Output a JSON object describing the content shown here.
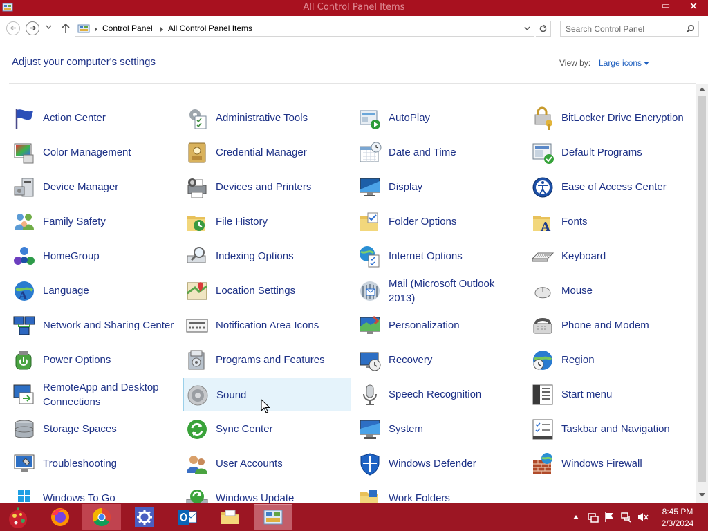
{
  "window": {
    "title": "All Control Panel Items",
    "minimize": "—",
    "maximize": "▭",
    "close": "✕"
  },
  "address": {
    "segments": [
      "Control Panel",
      "All Control Panel Items"
    ],
    "search_placeholder": "Search Control Panel"
  },
  "header": {
    "title": "Adjust your computer's settings",
    "view_by_label": "View by:",
    "view_by_value": "Large icons"
  },
  "items": [
    {
      "label": "Action Center",
      "icon": "flag-icon"
    },
    {
      "label": "Administrative Tools",
      "icon": "admin-tools-icon"
    },
    {
      "label": "AutoPlay",
      "icon": "autoplay-icon"
    },
    {
      "label": "BitLocker Drive Encryption",
      "icon": "bitlocker-icon"
    },
    {
      "label": "Color Management",
      "icon": "color-management-icon"
    },
    {
      "label": "Credential Manager",
      "icon": "credential-manager-icon"
    },
    {
      "label": "Date and Time",
      "icon": "date-time-icon"
    },
    {
      "label": "Default Programs",
      "icon": "default-programs-icon"
    },
    {
      "label": "Device Manager",
      "icon": "device-manager-icon"
    },
    {
      "label": "Devices and Printers",
      "icon": "printer-icon"
    },
    {
      "label": "Display",
      "icon": "display-icon"
    },
    {
      "label": "Ease of Access Center",
      "icon": "ease-of-access-icon"
    },
    {
      "label": "Family Safety",
      "icon": "family-safety-icon"
    },
    {
      "label": "File History",
      "icon": "file-history-icon"
    },
    {
      "label": "Folder Options",
      "icon": "folder-options-icon"
    },
    {
      "label": "Fonts",
      "icon": "fonts-icon"
    },
    {
      "label": "HomeGroup",
      "icon": "homegroup-icon"
    },
    {
      "label": "Indexing Options",
      "icon": "indexing-icon"
    },
    {
      "label": "Internet Options",
      "icon": "internet-options-icon"
    },
    {
      "label": "Keyboard",
      "icon": "keyboard-icon"
    },
    {
      "label": "Language",
      "icon": "language-icon"
    },
    {
      "label": "Location Settings",
      "icon": "location-icon"
    },
    {
      "label": "Mail (Microsoft Outlook 2013)",
      "icon": "mail-icon"
    },
    {
      "label": "Mouse",
      "icon": "mouse-icon"
    },
    {
      "label": "Network and Sharing Center",
      "icon": "network-icon"
    },
    {
      "label": "Notification Area Icons",
      "icon": "notification-icon"
    },
    {
      "label": "Personalization",
      "icon": "personalization-icon"
    },
    {
      "label": "Phone and Modem",
      "icon": "phone-icon"
    },
    {
      "label": "Power Options",
      "icon": "power-icon"
    },
    {
      "label": "Programs and Features",
      "icon": "programs-icon"
    },
    {
      "label": "Recovery",
      "icon": "recovery-icon"
    },
    {
      "label": "Region",
      "icon": "region-icon"
    },
    {
      "label": "RemoteApp and Desktop Connections",
      "icon": "remoteapp-icon"
    },
    {
      "label": "Sound",
      "icon": "speaker-icon"
    },
    {
      "label": "Speech Recognition",
      "icon": "microphone-icon"
    },
    {
      "label": "Start menu",
      "icon": "start-menu-icon"
    },
    {
      "label": "Storage Spaces",
      "icon": "storage-icon"
    },
    {
      "label": "Sync Center",
      "icon": "sync-icon"
    },
    {
      "label": "System",
      "icon": "system-icon"
    },
    {
      "label": "Taskbar and Navigation",
      "icon": "taskbar-nav-icon"
    },
    {
      "label": "Troubleshooting",
      "icon": "troubleshooting-icon"
    },
    {
      "label": "User Accounts",
      "icon": "user-accounts-icon"
    },
    {
      "label": "Windows Defender",
      "icon": "shield-icon"
    },
    {
      "label": "Windows Firewall",
      "icon": "firewall-icon"
    },
    {
      "label": "Windows To Go",
      "icon": "windows-to-go-icon"
    },
    {
      "label": "Windows Update",
      "icon": "windows-update-icon"
    },
    {
      "label": "Work Folders",
      "icon": "work-folders-icon"
    }
  ],
  "selected_item": "Sound",
  "taskbar": {
    "apps": [
      "Firefox",
      "Chrome",
      "Settings",
      "Outlook",
      "File Explorer",
      "Control Panel"
    ],
    "time": "8:45 PM",
    "date": "2/3/2024"
  },
  "colors": {
    "titlebar": "#a8111f",
    "taskbar": "#9c1623",
    "link": "#1e3287",
    "selection": "#e5f3fb"
  }
}
